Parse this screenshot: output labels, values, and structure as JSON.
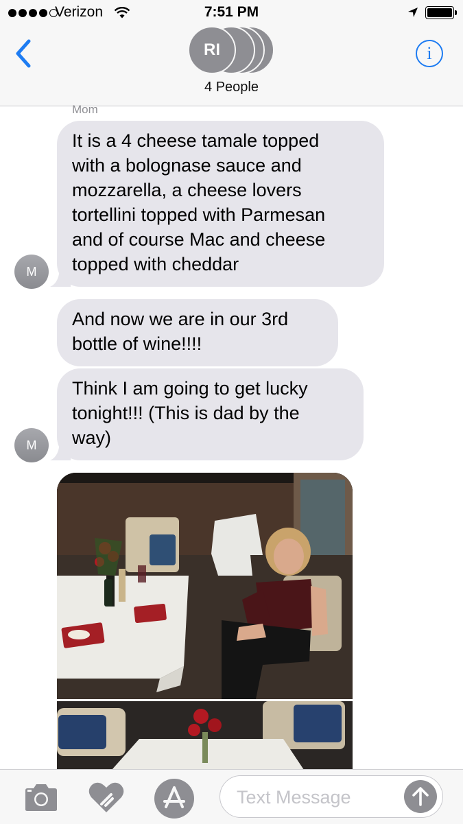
{
  "status_bar": {
    "carrier": "Verizon",
    "time": "7:51 PM",
    "signal_bars_filled": 4,
    "signal_bars_total": 5,
    "battery_level": 1.0
  },
  "header": {
    "avatar_initials": "RI",
    "group_label": "4 People",
    "info_glyph": "i",
    "back_icon": "chevron-left-icon",
    "accent_color": "#1e7cf2"
  },
  "messages": {
    "sender_name": "Mom",
    "sender_initial": "M",
    "bubble_color": "#e6e5eb",
    "items": [
      {
        "lines": [
          "It is a 4 cheese tamale topped",
          "with a bolognase sauce and",
          "mozzarella, a cheese lovers",
          "tortellini topped with Parmesan",
          "and of course Mac and cheese",
          "topped with cheddar"
        ]
      },
      {
        "lines": [
          "And now we are in our 3rd",
          "bottle of wine!!!!"
        ]
      },
      {
        "lines": [
          "Think I am going to get lucky",
          "tonight!!! (This is dad by the",
          "way)"
        ]
      }
    ]
  },
  "input_bar": {
    "placeholder": "Text Message",
    "icons": [
      "camera-icon",
      "digital-touch-heart-icon",
      "app-store-icon",
      "send-arrow-icon"
    ]
  }
}
